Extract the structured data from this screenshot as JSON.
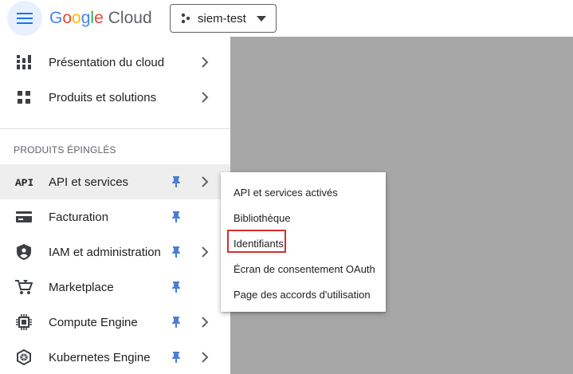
{
  "header": {
    "logo_google": "Google",
    "logo_cloud": "Cloud",
    "project_name": "siem-test"
  },
  "sidebar": {
    "top_items": [
      {
        "label": "Présentation du cloud",
        "icon": "dashboard-icon"
      },
      {
        "label": "Produits et solutions",
        "icon": "apps-grid-icon"
      }
    ],
    "pinned_header": "PRODUITS ÉPINGLÉS",
    "pinned_items": [
      {
        "label": "API et services",
        "icon": "api-icon",
        "active": true
      },
      {
        "label": "Facturation",
        "icon": "billing-icon"
      },
      {
        "label": "IAM et administration",
        "icon": "shield-icon"
      },
      {
        "label": "Marketplace",
        "icon": "cart-icon"
      },
      {
        "label": "Compute Engine",
        "icon": "chip-icon"
      },
      {
        "label": "Kubernetes Engine",
        "icon": "kubernetes-icon"
      }
    ]
  },
  "submenu": {
    "items": [
      "API et services activés",
      "Bibliothèque",
      "Identifiants",
      "Écran de consentement OAuth",
      "Page des accords d'utilisation"
    ]
  },
  "colors": {
    "pin_blue": "#4a7fd4",
    "highlight_red": "#d32f2f",
    "scrim_gray": "#a7a7a7"
  }
}
